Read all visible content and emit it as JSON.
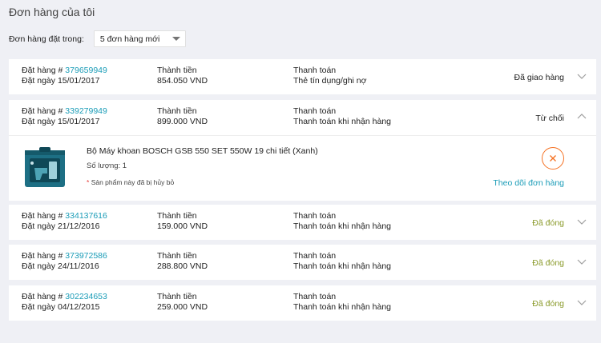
{
  "page_title": "Đơn hàng của tôi",
  "filter": {
    "label": "Đơn hàng đặt trong:",
    "selected": "5 đơn hàng mới"
  },
  "colors": {
    "background": "#eff0f5",
    "link": "#1a9cb7",
    "closed_status": "#8a9a2a",
    "cancel_accent": "#f57224"
  },
  "orders": [
    {
      "order_label": "Đặt hàng #",
      "order_number": "379659949",
      "date_label": "Đặt ngày",
      "date": "15/01/2017",
      "total_label": "Thành tiền",
      "total": "854.050 VND",
      "payment_label": "Thanh toán",
      "payment": "Thẻ tín dụng/ghi nợ",
      "status": "Đã giao hàng",
      "expanded": false
    },
    {
      "order_label": "Đặt hàng #",
      "order_number": "339279949",
      "date_label": "Đặt ngày",
      "date": "15/01/2017",
      "total_label": "Thành tiền",
      "total": "899.000 VND",
      "payment_label": "Thanh toán",
      "payment": "Thanh toán khi nhận hàng",
      "status": "Từ chối",
      "expanded": true,
      "item": {
        "name": "Bộ Máy khoan BOSCH GSB 550 SET 550W 19 chi tiết (Xanh)",
        "quantity": "Số lượng: 1",
        "note_star": "*",
        "note": "Sản phẩm này đã bị hủy bỏ",
        "track_link": "Theo dõi đơn hàng"
      }
    },
    {
      "order_label": "Đặt hàng #",
      "order_number": "334137616",
      "date_label": "Đặt ngày",
      "date": "21/12/2016",
      "total_label": "Thành tiền",
      "total": "159.000 VND",
      "payment_label": "Thanh toán",
      "payment": "Thanh toán khi nhận hàng",
      "status": "Đã đóng",
      "expanded": false
    },
    {
      "order_label": "Đặt hàng #",
      "order_number": "373972586",
      "date_label": "Đặt ngày",
      "date": "24/11/2016",
      "total_label": "Thành tiền",
      "total": "288.800 VND",
      "payment_label": "Thanh toán",
      "payment": "Thanh toán khi nhận hàng",
      "status": "Đã đóng",
      "expanded": false
    },
    {
      "order_label": "Đặt hàng #",
      "order_number": "302234653",
      "date_label": "Đặt ngày",
      "date": "04/12/2015",
      "total_label": "Thành tiền",
      "total": "259.000 VND",
      "payment_label": "Thanh toán",
      "payment": "Thanh toán khi nhận hàng",
      "status": "Đã đóng",
      "expanded": false
    }
  ]
}
